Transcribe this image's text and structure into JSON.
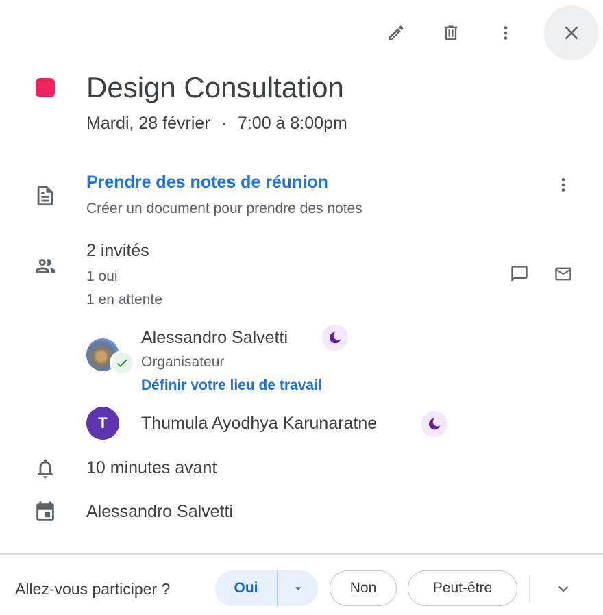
{
  "toolbar": {
    "edit_icon": "pencil-icon",
    "delete_icon": "trash-icon",
    "more_icon": "more-vert-icon",
    "close_icon": "close-icon"
  },
  "event": {
    "color": "#f0215e",
    "title": "Design Consultation",
    "date": "Mardi, 28 février",
    "separator": "·",
    "time": "7:00 à 8:00pm"
  },
  "notes": {
    "title": "Prendre des notes de réunion",
    "subtitle": "Créer un document pour prendre des notes"
  },
  "guests": {
    "summary": "2 invités",
    "yes_count": "1 oui",
    "pending_count": "1 en attente",
    "list": [
      {
        "name": "Alessandro Salvetti",
        "role": "Organisateur",
        "workplace_link": "Définir votre lieu de travail",
        "status": "accepted"
      },
      {
        "initial": "T",
        "name": "Thumula Ayodhya Karunaratne"
      }
    ]
  },
  "reminder": "10 minutes avant",
  "calendar_owner": "Alessandro Salvetti",
  "rsvp": {
    "question": "Allez-vous participer ?",
    "yes": "Oui",
    "no": "Non",
    "maybe": "Peut-être"
  },
  "colors": {
    "accent": "#1a73e8",
    "event": "#f0215e",
    "avatar_t": "#5e35b1"
  }
}
